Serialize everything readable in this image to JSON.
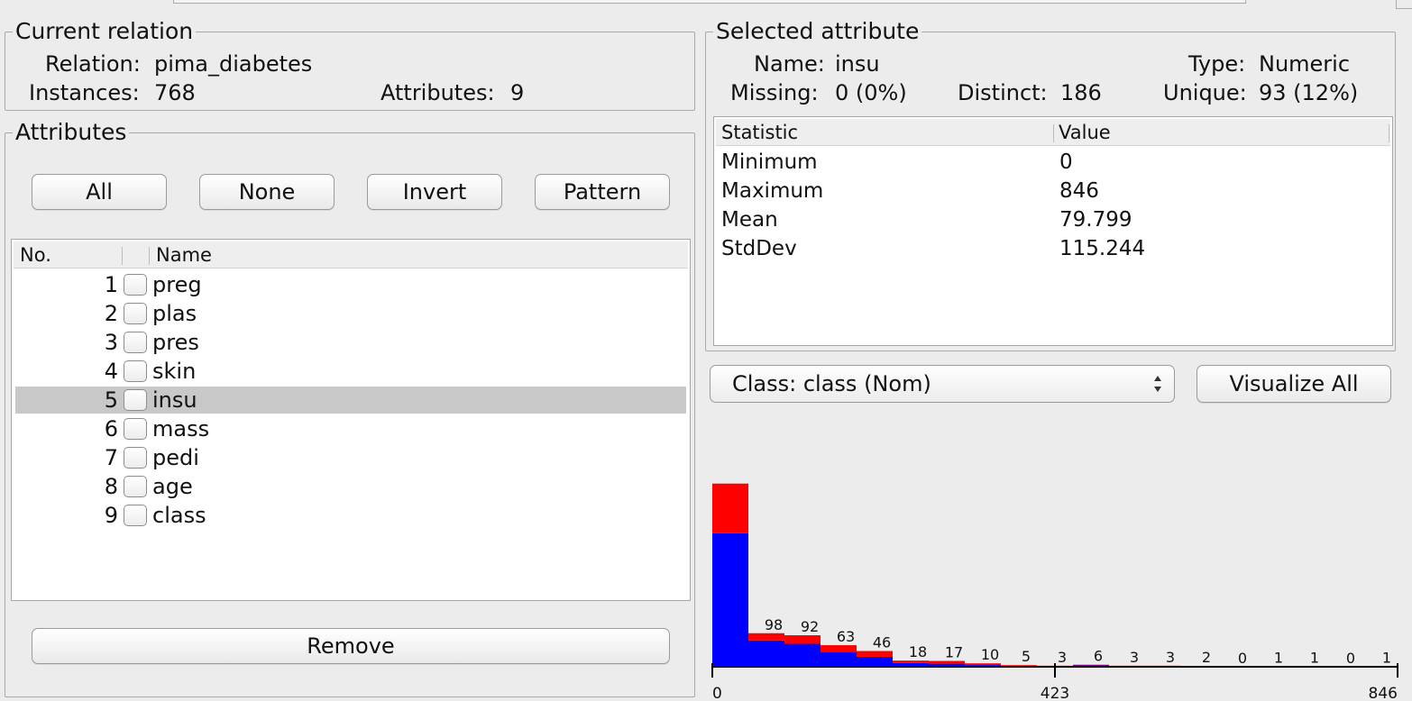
{
  "current_relation": {
    "legend": "Current relation",
    "relation_label": "Relation:",
    "relation_value": "pima_diabetes",
    "instances_label": "Instances:",
    "instances_value": "768",
    "attributes_label": "Attributes:",
    "attributes_value": "9"
  },
  "attributes_panel": {
    "legend": "Attributes",
    "buttons": {
      "all": "All",
      "none": "None",
      "invert": "Invert",
      "pattern": "Pattern"
    },
    "columns": {
      "no": "No.",
      "name": "Name"
    },
    "rows": [
      {
        "no": "1",
        "name": "preg",
        "selected": false
      },
      {
        "no": "2",
        "name": "plas",
        "selected": false
      },
      {
        "no": "3",
        "name": "pres",
        "selected": false
      },
      {
        "no": "4",
        "name": "skin",
        "selected": false
      },
      {
        "no": "5",
        "name": "insu",
        "selected": true
      },
      {
        "no": "6",
        "name": "mass",
        "selected": false
      },
      {
        "no": "7",
        "name": "pedi",
        "selected": false
      },
      {
        "no": "8",
        "name": "age",
        "selected": false
      },
      {
        "no": "9",
        "name": "class",
        "selected": false
      }
    ],
    "remove_label": "Remove"
  },
  "selected_attribute": {
    "legend": "Selected attribute",
    "name_label": "Name:",
    "name_value": "insu",
    "type_label": "Type:",
    "type_value": "Numeric",
    "missing_label": "Missing:",
    "missing_value": "0 (0%)",
    "distinct_label": "Distinct:",
    "distinct_value": "186",
    "unique_label": "Unique:",
    "unique_value": "93 (12%)",
    "stats_columns": {
      "statistic": "Statistic",
      "value": "Value"
    },
    "stats": [
      {
        "statistic": "Minimum",
        "value": "0"
      },
      {
        "statistic": "Maximum",
        "value": "846"
      },
      {
        "statistic": "Mean",
        "value": "79.799"
      },
      {
        "statistic": "StdDev",
        "value": "115.244"
      }
    ]
  },
  "class_select": {
    "value": "Class: class (Nom)"
  },
  "visualize_all_label": "Visualize All",
  "colors": {
    "class_blue": "#0000ff",
    "class_red": "#ff0000"
  },
  "chart_data": {
    "type": "bar",
    "stacked": true,
    "x_ticks": [
      "0",
      "423",
      "846"
    ],
    "xlim": [
      0,
      846
    ],
    "bin_count": 19,
    "labels": [
      "",
      "98",
      "92",
      "63",
      "46",
      "18",
      "17",
      "10",
      "5",
      "3",
      "6",
      "3",
      "3",
      "2",
      "0",
      "1",
      "1",
      "0",
      "1"
    ],
    "series": [
      {
        "color": "#0000ff",
        "values": [
          390,
          77,
          67,
          42,
          29,
          11,
          9,
          5,
          3,
          2,
          4,
          1,
          1,
          1,
          0,
          0,
          1,
          0,
          0
        ]
      },
      {
        "color": "#ff0000",
        "values": [
          145,
          21,
          25,
          21,
          17,
          7,
          8,
          5,
          2,
          1,
          2,
          2,
          2,
          1,
          0,
          1,
          0,
          0,
          1
        ]
      }
    ]
  }
}
